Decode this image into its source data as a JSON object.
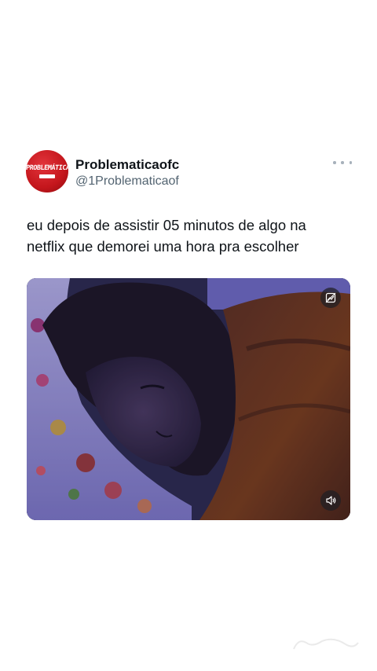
{
  "tweet": {
    "author": {
      "display_name": "Problematicaofc",
      "handle": "@1Problematicaof",
      "avatar_text": "PROBLEMÁTICA"
    },
    "text_lines": [
      "eu depois de assistir 05 minutos de algo na",
      "netflix que demorei uma hora pra escolher"
    ],
    "more_icon": "more-horizontal-icon",
    "media": {
      "type": "video",
      "top_icon": "image-description-icon",
      "bottom_icon": "volume-icon"
    }
  },
  "colors": {
    "name": "#0f1419",
    "handle": "#536471",
    "avatar": "#c4161c",
    "background": "#ffffff"
  }
}
